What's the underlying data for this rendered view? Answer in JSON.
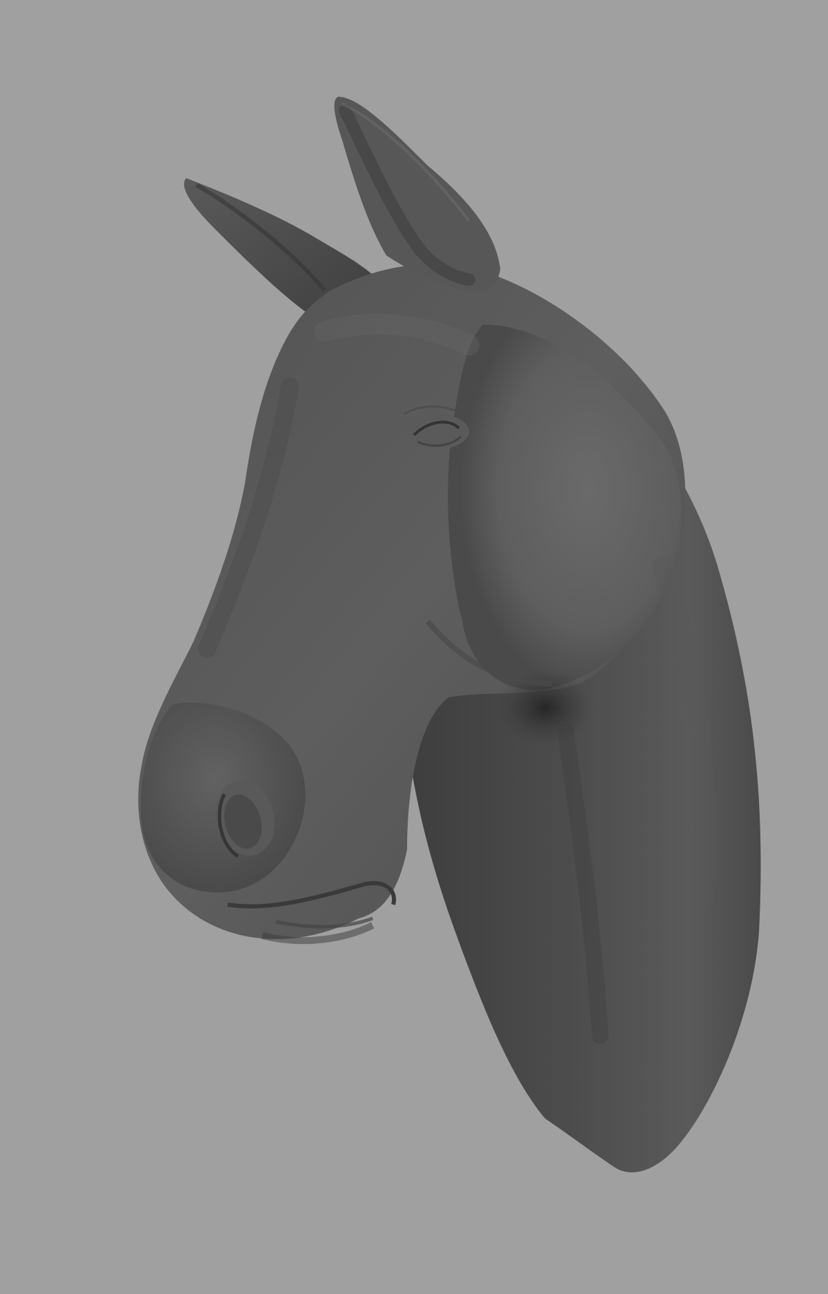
{
  "viewport": {
    "background_color": "#a0a0a0",
    "model_base_color": "#5c5c5c",
    "model_shadow_color": "#3a3a3a",
    "model_highlight_color": "#707070",
    "subject": "horse-head-sculpt"
  }
}
